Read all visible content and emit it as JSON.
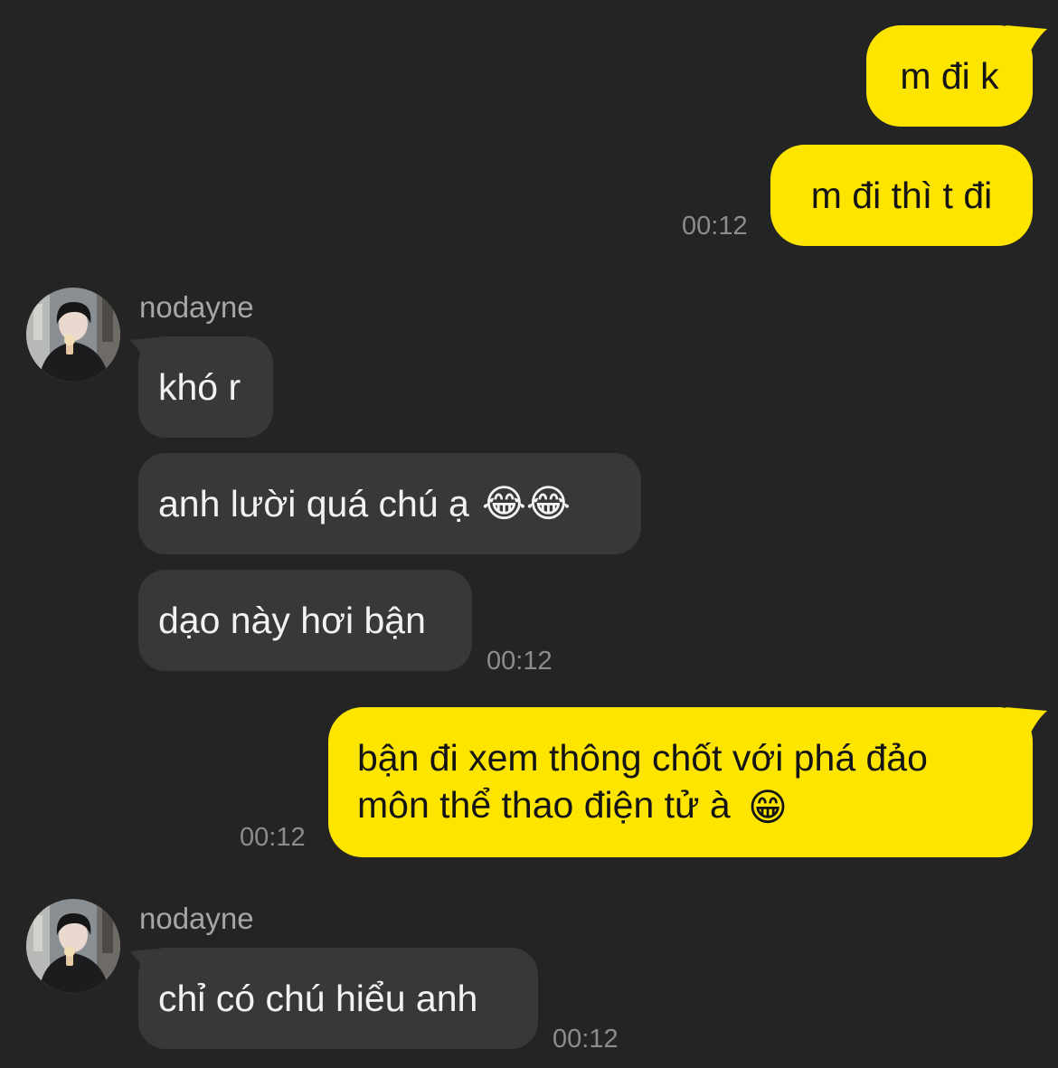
{
  "colors": {
    "background": "#242424",
    "outgoing_bubble": "#FEE500",
    "incoming_bubble": "#383838",
    "timestamp": "#8c8c8c",
    "sender_name": "#a6a6a6"
  },
  "messages": {
    "out1": {
      "text": "m đi k"
    },
    "out2": {
      "text": "m đi thì t đi",
      "time": "00:12"
    },
    "group1": {
      "sender": "nodayne",
      "avatar_icon": "profile-photo-avatar",
      "m1": {
        "text": "khó r"
      },
      "m2": {
        "text": "anh lười quá chú ạ",
        "emoji": "😂😂",
        "emoji_icon": "face-with-tears-of-joy-emoji"
      },
      "m3": {
        "text": "dạo này hơi bận",
        "time": "00:12"
      }
    },
    "out3": {
      "text": "bận đi xem thông chốt với phá đảo môn thể thao điện tử à",
      "emoji": "😁",
      "emoji_icon": "beaming-face-emoji",
      "time": "00:12"
    },
    "group2": {
      "sender": "nodayne",
      "avatar_icon": "profile-photo-avatar",
      "m1": {
        "text": "chỉ có chú hiểu anh",
        "time": "00:12"
      }
    }
  }
}
